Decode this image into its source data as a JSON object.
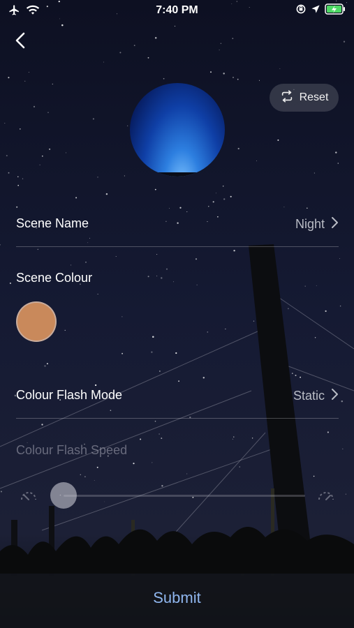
{
  "status_bar": {
    "time": "7:40 PM",
    "icons": [
      "airplane-icon",
      "wifi-icon",
      "screen-rotation-lock-icon",
      "location-icon",
      "battery-charging-icon"
    ]
  },
  "header": {
    "back_icon": "chevron-left-icon",
    "reset_label": "Reset",
    "reset_icon": "reset-arrows-icon"
  },
  "preview": {
    "colors": [
      "#7fc4ff",
      "#2d7fe0",
      "#0f3fa6",
      "#061a5c"
    ]
  },
  "scene_name": {
    "label": "Scene Name",
    "value": "Night"
  },
  "scene_colour": {
    "label": "Scene Colour",
    "color": "#c9895b"
  },
  "flash_mode": {
    "label": "Colour Flash Mode",
    "value": "Static"
  },
  "flash_speed": {
    "label": "Colour Flash Speed",
    "level": 0,
    "enabled": false
  },
  "footer": {
    "submit_label": "Submit"
  }
}
